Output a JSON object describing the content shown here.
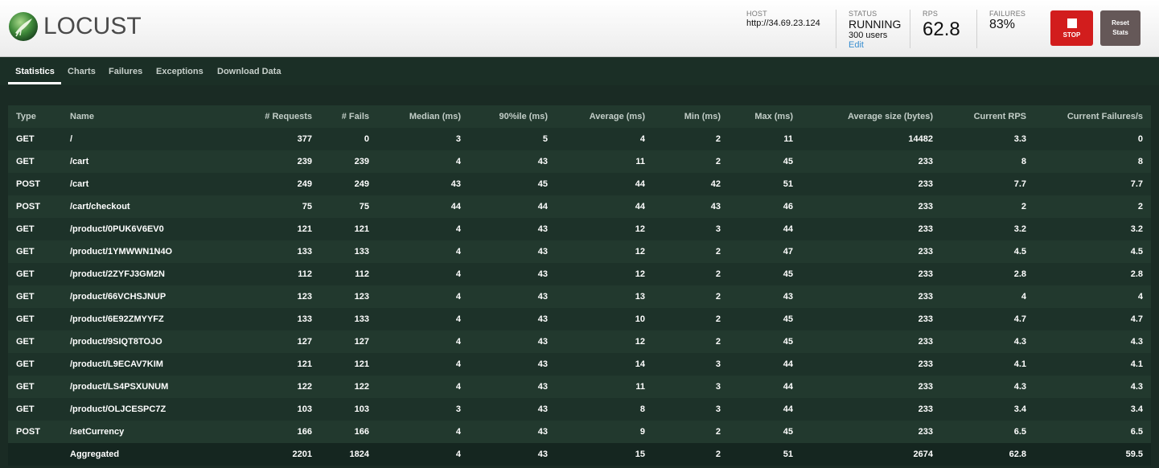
{
  "app": {
    "name": "LOCUST"
  },
  "header": {
    "host_label": "HOST",
    "host": "http://34.69.23.124",
    "status_label": "STATUS",
    "status": "RUNNING",
    "users": "300 users",
    "edit": "Edit",
    "rps_label": "RPS",
    "rps": "62.8",
    "failures_label": "FAILURES",
    "failures": "83%",
    "stop_label": "STOP",
    "reset_label_1": "Reset",
    "reset_label_2": "Stats"
  },
  "colors": {
    "stop": "#d21d1d",
    "reset": "#655858",
    "panel": "#22392e",
    "edit_link": "#3a8fd0"
  },
  "tabs": [
    "Statistics",
    "Charts",
    "Failures",
    "Exceptions",
    "Download Data"
  ],
  "active_tab": "Statistics",
  "table": {
    "columns": [
      "Type",
      "Name",
      "# Requests",
      "# Fails",
      "Median (ms)",
      "90%ile (ms)",
      "Average (ms)",
      "Min (ms)",
      "Max (ms)",
      "Average size (bytes)",
      "Current RPS",
      "Current Failures/s"
    ],
    "rows": [
      [
        "GET",
        "/",
        "377",
        "0",
        "3",
        "5",
        "4",
        "2",
        "11",
        "14482",
        "3.3",
        "0"
      ],
      [
        "GET",
        "/cart",
        "239",
        "239",
        "4",
        "43",
        "11",
        "2",
        "45",
        "233",
        "8",
        "8"
      ],
      [
        "POST",
        "/cart",
        "249",
        "249",
        "43",
        "45",
        "44",
        "42",
        "51",
        "233",
        "7.7",
        "7.7"
      ],
      [
        "POST",
        "/cart/checkout",
        "75",
        "75",
        "44",
        "44",
        "44",
        "43",
        "46",
        "233",
        "2",
        "2"
      ],
      [
        "GET",
        "/product/0PUK6V6EV0",
        "121",
        "121",
        "4",
        "43",
        "12",
        "3",
        "44",
        "233",
        "3.2",
        "3.2"
      ],
      [
        "GET",
        "/product/1YMWWN1N4O",
        "133",
        "133",
        "4",
        "43",
        "12",
        "2",
        "47",
        "233",
        "4.5",
        "4.5"
      ],
      [
        "GET",
        "/product/2ZYFJ3GM2N",
        "112",
        "112",
        "4",
        "43",
        "12",
        "2",
        "45",
        "233",
        "2.8",
        "2.8"
      ],
      [
        "GET",
        "/product/66VCHSJNUP",
        "123",
        "123",
        "4",
        "43",
        "13",
        "2",
        "43",
        "233",
        "4",
        "4"
      ],
      [
        "GET",
        "/product/6E92ZMYYFZ",
        "133",
        "133",
        "4",
        "43",
        "10",
        "2",
        "45",
        "233",
        "4.7",
        "4.7"
      ],
      [
        "GET",
        "/product/9SIQT8TOJO",
        "127",
        "127",
        "4",
        "43",
        "12",
        "2",
        "45",
        "233",
        "4.3",
        "4.3"
      ],
      [
        "GET",
        "/product/L9ECAV7KIM",
        "121",
        "121",
        "4",
        "43",
        "14",
        "3",
        "44",
        "233",
        "4.1",
        "4.1"
      ],
      [
        "GET",
        "/product/LS4PSXUNUM",
        "122",
        "122",
        "4",
        "43",
        "11",
        "3",
        "44",
        "233",
        "4.3",
        "4.3"
      ],
      [
        "GET",
        "/product/OLJCESPC7Z",
        "103",
        "103",
        "3",
        "43",
        "8",
        "3",
        "44",
        "233",
        "3.4",
        "3.4"
      ],
      [
        "POST",
        "/setCurrency",
        "166",
        "166",
        "4",
        "43",
        "9",
        "2",
        "45",
        "233",
        "6.5",
        "6.5"
      ]
    ],
    "aggregated": [
      "",
      "Aggregated",
      "2201",
      "1824",
      "4",
      "43",
      "15",
      "2",
      "51",
      "2674",
      "62.8",
      "59.5"
    ]
  }
}
